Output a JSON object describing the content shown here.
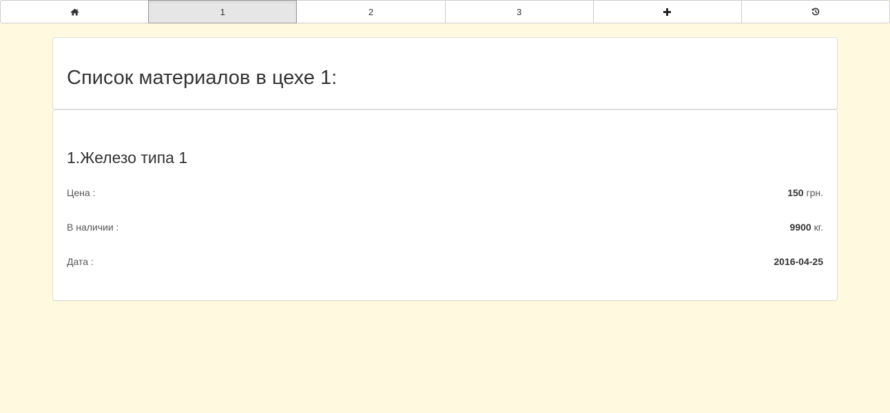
{
  "nav": {
    "items": [
      {
        "icon": "home-icon",
        "label": ""
      },
      {
        "icon": "",
        "label": "1"
      },
      {
        "icon": "",
        "label": "2"
      },
      {
        "icon": "",
        "label": "3"
      },
      {
        "icon": "plus-icon",
        "label": ""
      },
      {
        "icon": "history-icon",
        "label": ""
      }
    ],
    "active": "1"
  },
  "header": {
    "title": "Список материалов в цехе 1:"
  },
  "materials": [
    {
      "title": "1.Железо типа 1",
      "price_label": "Цена :",
      "price_value": "150",
      "price_unit": " грн.",
      "stock_label": "В наличии :",
      "stock_value": "9900",
      "stock_unit": " кг.",
      "date_label": "Дата :",
      "date_value": "2016-04-25"
    }
  ],
  "colors": {
    "background": "#fff9e0",
    "panel": "#ffffff",
    "active_tab": "#e6e6e6"
  }
}
